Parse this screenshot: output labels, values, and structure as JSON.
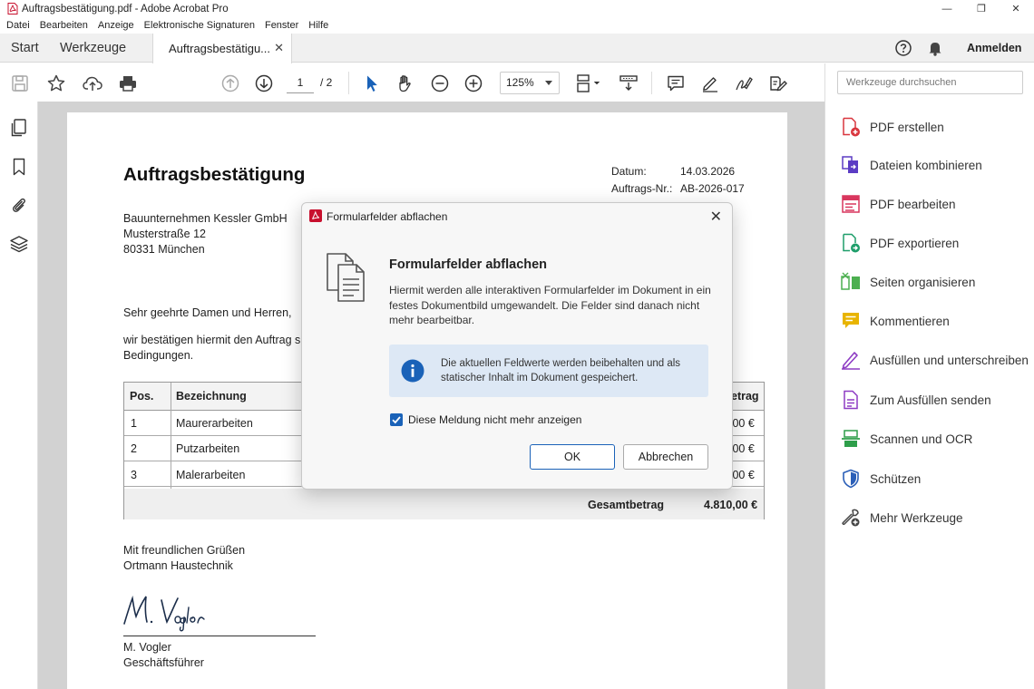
{
  "window": {
    "title": "Auftragsbestätigung.pdf - Adobe Acrobat Pro",
    "minimize_glyph": "—",
    "restore_glyph": "❐",
    "close_glyph": "✕"
  },
  "menu": [
    "Datei",
    "Bearbeiten",
    "Anzeige",
    "Elektronische Signaturen",
    "Fenster",
    "Hilfe"
  ],
  "tabs": {
    "start": "Start",
    "tools": "Werkzeuge",
    "document": "Auftragsbestätigu...",
    "close_glyph": "✕"
  },
  "header": {
    "signin": "Anmelden"
  },
  "toolbar": {
    "page_current": "1",
    "page_total": "/ 2",
    "zoom": "125%"
  },
  "document": {
    "title": "Auftragsbestätigung",
    "meta": [
      {
        "label": "Datum:",
        "value": "14.03.2026"
      },
      {
        "label": "Auftrags-Nr.:",
        "value": "AB-2026-017"
      }
    ],
    "address": [
      "Bauunternehmen Kessler GmbH",
      "Musterstraße 12",
      "80331 München"
    ],
    "greeting": "Sehr geehrte Damen und Herren,",
    "body_line1": "wir bestätigen hiermit den Auftrag s",
    "body_line2": "Bedingungen.",
    "table": {
      "headers": {
        "pos": "Pos.",
        "desc": "Bezeichnung",
        "amount": "etrag"
      },
      "rows": [
        {
          "pos": "1",
          "desc": "Maurerarbeiten",
          "amount": ",00 €"
        },
        {
          "pos": "2",
          "desc": "Putzarbeiten",
          "amount": ",00 €"
        },
        {
          "pos": "3",
          "desc": "Malerarbeiten",
          "amount": ",00 €"
        }
      ],
      "total_label": "Gesamtbetrag",
      "total_value": "4.810,00 €"
    },
    "closing": [
      "Mit freundlichen Grüßen",
      "Ortmann Haustechnik"
    ],
    "signature": "M. Vogler",
    "signer_name": "M. Vogler",
    "signer_role": "Geschäftsführer"
  },
  "tools_panel": {
    "search_placeholder": "Werkzeuge durchsuchen",
    "items": [
      {
        "label": "PDF erstellen",
        "icon": "pdf-create-icon",
        "color": "#d9363e"
      },
      {
        "label": "Dateien kombinieren",
        "icon": "combine-files-icon",
        "color": "#5b3cc4"
      },
      {
        "label": "PDF bearbeiten",
        "icon": "edit-pdf-icon",
        "color": "#d9365e"
      },
      {
        "label": "PDF exportieren",
        "icon": "export-pdf-icon",
        "color": "#1e9e6a"
      },
      {
        "label": "Seiten organisieren",
        "icon": "organize-pages-icon",
        "color": "#4caf50"
      },
      {
        "label": "Kommentieren",
        "icon": "comment-icon",
        "color": "#e8b400"
      },
      {
        "label": "Ausfüllen und unterschreiben",
        "icon": "fill-sign-icon",
        "color": "#8e3cc4"
      },
      {
        "label": "Zum Ausfüllen senden",
        "icon": "send-for-fill-icon",
        "color": "#8e3cc4"
      },
      {
        "label": "Scannen und OCR",
        "icon": "scan-ocr-icon",
        "color": "#2e9e4a"
      },
      {
        "label": "Schützen",
        "icon": "protect-shield-icon",
        "color": "#2b5fb8"
      },
      {
        "label": "Mehr Werkzeuge",
        "icon": "more-tools-icon",
        "color": "#444444"
      }
    ]
  },
  "dialog": {
    "title": "Formularfelder abflachen",
    "heading": "Formularfelder abflachen",
    "text": "Hiermit werden alle interaktiven Formularfelder im Dokument in ein festes Dokumentbild umgewandelt. Die Felder sind danach nicht mehr bearbeitbar.",
    "info": "Die aktuellen Feldwerte werden beibehalten und als statischer Inhalt im Dokument gespeichert.",
    "checkbox_label": "Diese Meldung nicht mehr anzeigen",
    "checkbox_checked": true,
    "ok": "OK",
    "cancel": "Abbrechen",
    "close_glyph": "✕"
  },
  "colors": {
    "accent": "#1a62b8",
    "acrobat_red": "#c8102e",
    "info_bg": "#dde8f5"
  }
}
